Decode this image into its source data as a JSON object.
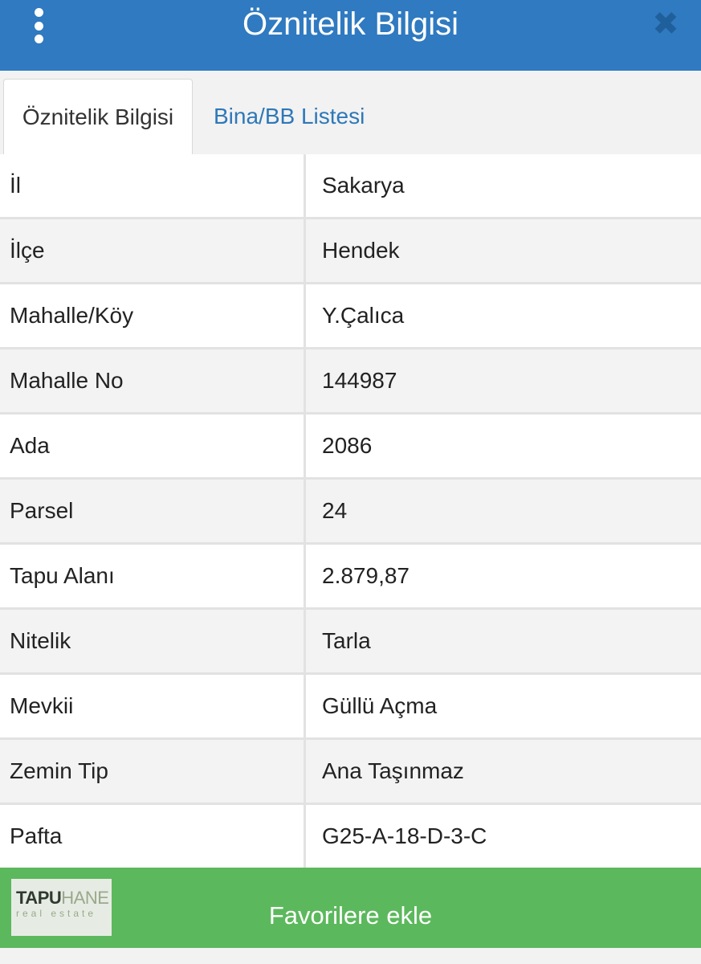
{
  "header": {
    "title": "Öznitelik Bilgisi",
    "menu_icon": "vertical-dots-icon",
    "close_icon": "close-icon",
    "close_glyph": "✖"
  },
  "tabs": [
    {
      "label": "Öznitelik Bilgisi",
      "active": true
    },
    {
      "label": "Bina/BB Listesi",
      "active": false
    }
  ],
  "rows": [
    {
      "label": "İl",
      "value": "Sakarya"
    },
    {
      "label": "İlçe",
      "value": "Hendek"
    },
    {
      "label": "Mahalle/Köy",
      "value": "Y.Çalıca"
    },
    {
      "label": "Mahalle No",
      "value": "144987"
    },
    {
      "label": "Ada",
      "value": "2086"
    },
    {
      "label": "Parsel",
      "value": "24"
    },
    {
      "label": "Tapu Alanı",
      "value": "2.879,87"
    },
    {
      "label": "Nitelik",
      "value": "Tarla"
    },
    {
      "label": "Mevkii",
      "value": "Güllü Açma"
    },
    {
      "label": "Zemin Tip",
      "value": "Ana Taşınmaz"
    },
    {
      "label": "Pafta",
      "value": "G25-A-18-D-3-C"
    }
  ],
  "footer": {
    "favorite_label": "Favorilere ekle",
    "logo_part1": "TAPU",
    "logo_part2": "HANE",
    "logo_sub": "real estate"
  },
  "colors": {
    "header_bg": "#2f7ac0",
    "footer_bg": "#5cb85c",
    "tab_link": "#2e78b8"
  }
}
